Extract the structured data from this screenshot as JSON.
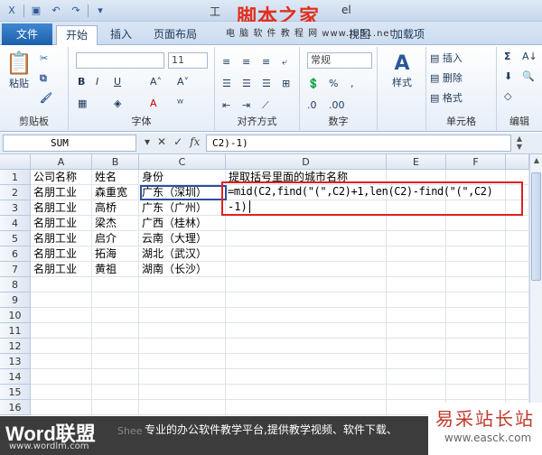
{
  "title": {
    "text": "工",
    "doc_suffix": "el"
  },
  "watermark_top": {
    "brand": "脚本之家",
    "site": "www.jb51.net",
    "tagline": "电 脑 软 件 教 程 网"
  },
  "tabs": [
    "文件",
    "开始",
    "插入",
    "页面布局",
    "视图",
    "加载项"
  ],
  "ribbon": {
    "clipboard": {
      "label": "剪贴板",
      "paste": "粘贴"
    },
    "font": {
      "label": "字体",
      "size": "11"
    },
    "align": {
      "label": "对齐方式"
    },
    "number": {
      "label": "数字",
      "format": "常规"
    },
    "styles": {
      "label": "样式"
    },
    "cells": {
      "label": "单元格",
      "insert": "插入",
      "delete": "删除",
      "format": "格式"
    },
    "editing": {
      "label": "编辑"
    }
  },
  "formula_bar": {
    "name_box": "SUM",
    "formula": "C2)-1)"
  },
  "columns": [
    "A",
    "B",
    "C",
    "D",
    "E",
    "F"
  ],
  "rows": [
    {
      "num": "1",
      "a": "公司名称",
      "b": "姓名",
      "c": "身份",
      "d": "提取括号里面的城市名称"
    },
    {
      "num": "2",
      "a": "名朋工业",
      "b": "森重宽",
      "c": "广东（深圳）",
      "d": ""
    },
    {
      "num": "3",
      "a": "名朋工业",
      "b": "高桥",
      "c": "广东（广州）",
      "d": ""
    },
    {
      "num": "4",
      "a": "名朋工业",
      "b": "梁杰",
      "c": "广西（桂林）",
      "d": ""
    },
    {
      "num": "5",
      "a": "名朋工业",
      "b": "启介",
      "c": "云南（大理）",
      "d": ""
    },
    {
      "num": "6",
      "a": "名朋工业",
      "b": "拓海",
      "c": "湖北（武汉）",
      "d": ""
    },
    {
      "num": "7",
      "a": "名朋工业",
      "b": "黄祖",
      "c": "湖南（长沙）",
      "d": ""
    },
    {
      "num": "8"
    },
    {
      "num": "9"
    },
    {
      "num": "10"
    },
    {
      "num": "11"
    },
    {
      "num": "12"
    },
    {
      "num": "13"
    },
    {
      "num": "14"
    },
    {
      "num": "15"
    },
    {
      "num": "16"
    }
  ],
  "edit_formula": {
    "line1": "=mid(C2,find(\"(\",C2)+1,len(C2)-find(\"(\",C2)",
    "line2": "-1)"
  },
  "footer": {
    "brand": "Word联盟",
    "url": "www.wordlm.com",
    "text": "专业的办公软件教学平台,提供教学视频、软件下载、",
    "sheet": "Shee"
  },
  "watermark_bottom": {
    "brand": "易采站长站",
    "url": "www.easck.com"
  }
}
